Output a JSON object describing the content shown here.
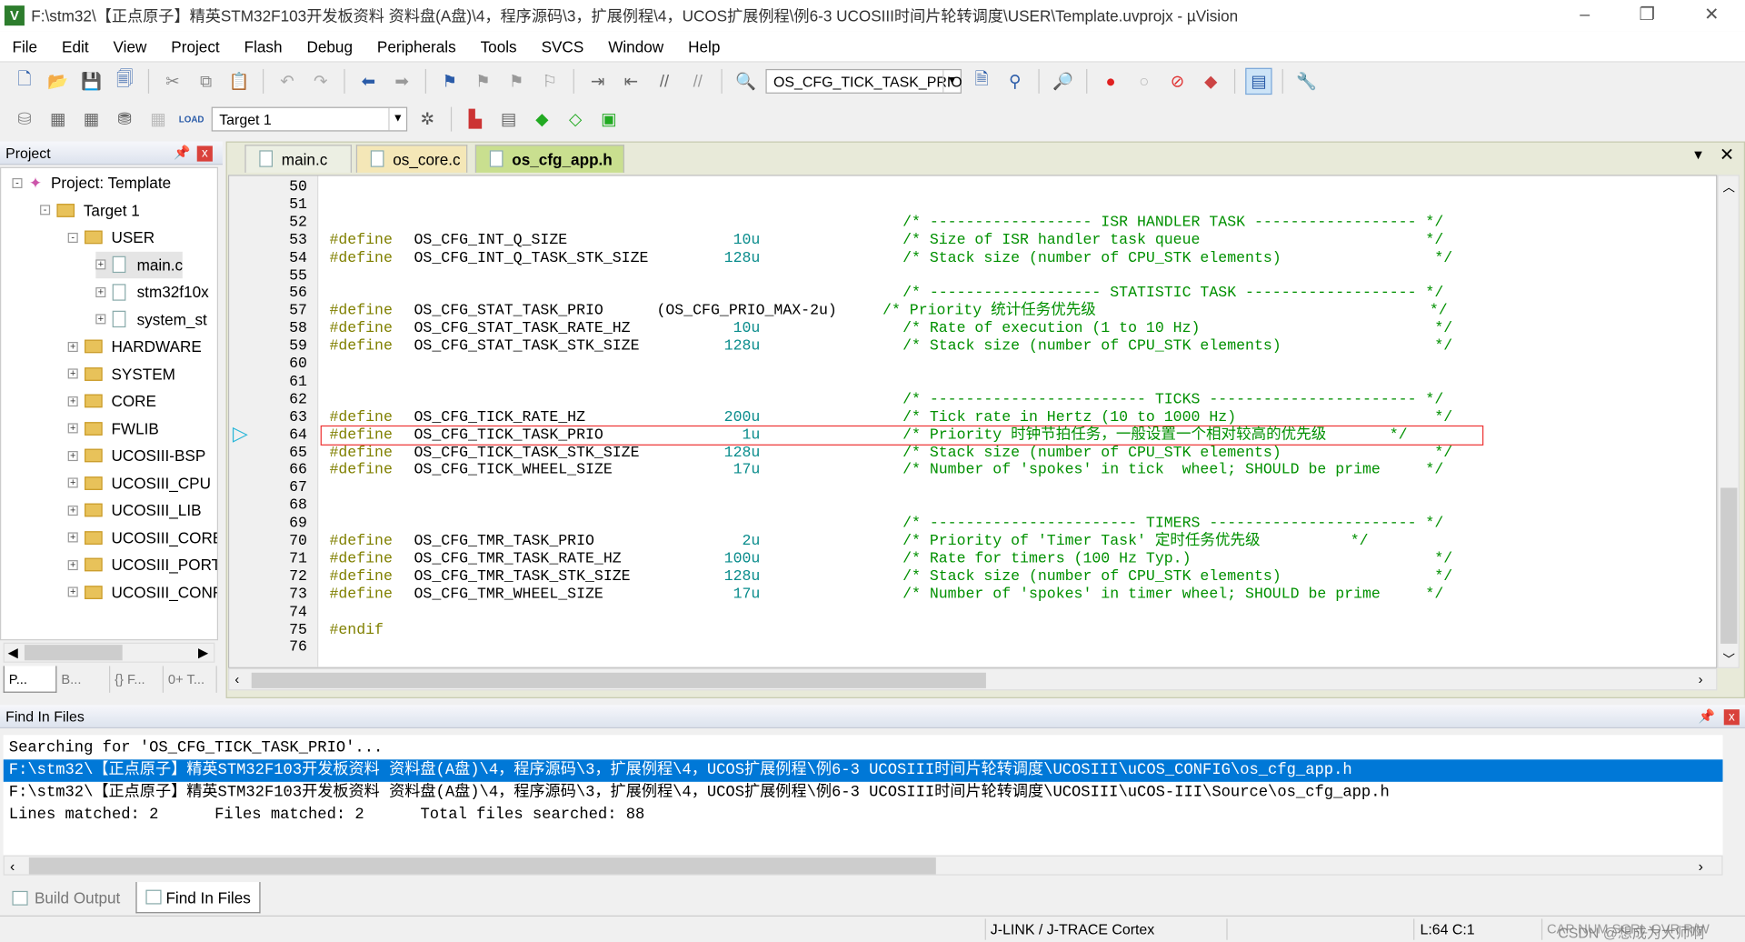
{
  "title": "F:\\stm32\\【正点原子】精英STM32F103开发板资料 资料盘(A盘)\\4，程序源码\\3，扩展例程\\4，UCOS扩展例程\\例6-3 UCOSIII时间片轮转调度\\USER\\Template.uvprojx - µVision",
  "menu": [
    "File",
    "Edit",
    "View",
    "Project",
    "Flash",
    "Debug",
    "Peripherals",
    "Tools",
    "SVCS",
    "Window",
    "Help"
  ],
  "toolbar": {
    "find_combo": "OS_CFG_TICK_TASK_PRIO",
    "target_combo": "Target 1",
    "load_label": "LOAD"
  },
  "project": {
    "header": "Project",
    "tree": [
      {
        "label": "Project: Template",
        "level": 0,
        "type": "project",
        "exp": "-"
      },
      {
        "label": "Target 1",
        "level": 1,
        "type": "target",
        "exp": "-"
      },
      {
        "label": "USER",
        "level": 2,
        "type": "folder",
        "exp": "-"
      },
      {
        "label": "main.c",
        "level": 3,
        "type": "file",
        "exp": "+"
      },
      {
        "label": "stm32f10x",
        "level": 3,
        "type": "file",
        "exp": "+"
      },
      {
        "label": "system_st",
        "level": 3,
        "type": "file",
        "exp": "+"
      },
      {
        "label": "HARDWARE",
        "level": 2,
        "type": "folder",
        "exp": "+"
      },
      {
        "label": "SYSTEM",
        "level": 2,
        "type": "folder",
        "exp": "+"
      },
      {
        "label": "CORE",
        "level": 2,
        "type": "folder",
        "exp": "+"
      },
      {
        "label": "FWLIB",
        "level": 2,
        "type": "folder",
        "exp": "+"
      },
      {
        "label": "UCOSIII-BSP",
        "level": 2,
        "type": "folder",
        "exp": "+"
      },
      {
        "label": "UCOSIII_CPU",
        "level": 2,
        "type": "folder",
        "exp": "+"
      },
      {
        "label": "UCOSIII_LIB",
        "level": 2,
        "type": "folder",
        "exp": "+"
      },
      {
        "label": "UCOSIII_CORE",
        "level": 2,
        "type": "folder",
        "exp": "+"
      },
      {
        "label": "UCOSIII_PORT",
        "level": 2,
        "type": "folder",
        "exp": "+"
      },
      {
        "label": "UCOSIII_CONFIG",
        "level": 2,
        "type": "folder",
        "exp": "+"
      }
    ],
    "tabs": [
      "P...",
      "B...",
      "{} F...",
      "0+ T..."
    ]
  },
  "editor": {
    "tabs": [
      "main.c",
      "os_core.c",
      "os_cfg_app.h"
    ],
    "active_tab": 2,
    "current_line": 64,
    "lines": [
      {
        "n": 50
      },
      {
        "n": 51
      },
      {
        "n": 52,
        "cm": "/* ------------------ ISR HANDLER TASK ------------------ */"
      },
      {
        "n": 53,
        "name": "OS_CFG_INT_Q_SIZE",
        "val": "10u",
        "cm": "/* Size of ISR handler task queue                         */"
      },
      {
        "n": 54,
        "name": "OS_CFG_INT_Q_TASK_STK_SIZE",
        "val": "128u",
        "cm": "/* Stack size (number of CPU_STK elements)                 */"
      },
      {
        "n": 55
      },
      {
        "n": 56,
        "cm": "/* ------------------- STATISTIC TASK ------------------- */"
      },
      {
        "n": 57,
        "name": "OS_CFG_STAT_TASK_PRIO",
        "val": "(OS_CFG_PRIO_MAX-2u)",
        "cm": "/* Priority 统计任务优先级                                     */"
      },
      {
        "n": 58,
        "name": "OS_CFG_STAT_TASK_RATE_HZ",
        "val": "10u",
        "cm": "/* Rate of execution (1 to 10 Hz)                          */"
      },
      {
        "n": 59,
        "name": "OS_CFG_STAT_TASK_STK_SIZE",
        "val": "128u",
        "cm": "/* Stack size (number of CPU_STK elements)                 */"
      },
      {
        "n": 60
      },
      {
        "n": 61
      },
      {
        "n": 62,
        "cm": "/* ------------------------ TICKS ----------------------- */"
      },
      {
        "n": 63,
        "name": "OS_CFG_TICK_RATE_HZ",
        "val": "200u",
        "cm": "/* Tick rate in Hertz (10 to 1000 Hz)                      */"
      },
      {
        "n": 64,
        "name": "OS_CFG_TICK_TASK_PRIO",
        "val": "1u",
        "cm": "/* Priority 时钟节拍任务，一般设置一个相对较高的优先级       */"
      },
      {
        "n": 65,
        "name": "OS_CFG_TICK_TASK_STK_SIZE",
        "val": "128u",
        "cm": "/* Stack size (number of CPU_STK elements)                 */"
      },
      {
        "n": 66,
        "name": "OS_CFG_TICK_WHEEL_SIZE",
        "val": "17u",
        "cm": "/* Number of 'spokes' in tick  wheel; SHOULD be prime     */"
      },
      {
        "n": 67
      },
      {
        "n": 68
      },
      {
        "n": 69,
        "cm": "/* ----------------------- TIMERS ----------------------- */"
      },
      {
        "n": 70,
        "name": "OS_CFG_TMR_TASK_PRIO",
        "val": "2u",
        "cm": "/* Priority of 'Timer Task' 定时任务优先级          */"
      },
      {
        "n": 71,
        "name": "OS_CFG_TMR_TASK_RATE_HZ",
        "val": "100u",
        "cm": "/* Rate for timers (100 Hz Typ.)                           */"
      },
      {
        "n": 72,
        "name": "OS_CFG_TMR_TASK_STK_SIZE",
        "val": "128u",
        "cm": "/* Stack size (number of CPU_STK elements)                 */"
      },
      {
        "n": 73,
        "name": "OS_CFG_TMR_WHEEL_SIZE",
        "val": "17u",
        "cm": "/* Number of 'spokes' in timer wheel; SHOULD be prime     */"
      },
      {
        "n": 74
      },
      {
        "n": 75,
        "kw": "#endif"
      },
      {
        "n": 76
      }
    ],
    "define_kw": "#define"
  },
  "find": {
    "header": "Find In Files",
    "lines": [
      "Searching for 'OS_CFG_TICK_TASK_PRIO'...",
      "F:\\stm32\\【正点原子】精英STM32F103开发板资料 资料盘(A盘)\\4，程序源码\\3，扩展例程\\4，UCOS扩展例程\\例6-3 UCOSIII时间片轮转调度\\UCOSIII\\uCOS_CONFIG\\os_cfg_app.h",
      "F:\\stm32\\【正点原子】精英STM32F103开发板资料 资料盘(A盘)\\4，程序源码\\3，扩展例程\\4，UCOS扩展例程\\例6-3 UCOSIII时间片轮转调度\\UCOSIII\\uCOS-III\\Source\\os_cfg_app.h",
      "Lines matched: 2      Files matched: 2      Total files searched: 88"
    ],
    "selected_line": 1
  },
  "bottom_tabs": [
    "Build Output",
    "Find In Files"
  ],
  "status": {
    "debugger": "J-LINK / J-TRACE Cortex",
    "position": "L:64 C:1",
    "caps": "CAP NUM SCRL OVR R/W",
    "watermark": "CSDN @想成为大师啊"
  },
  "colors": {
    "keyword": "#808000",
    "number": "#098c8c",
    "comment": "#009000",
    "selection": "#0078d7",
    "highlight_box": "#e33333"
  }
}
